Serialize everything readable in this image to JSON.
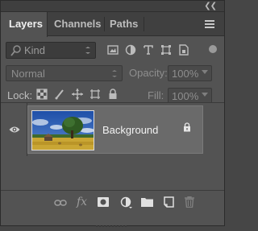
{
  "panel": {
    "tabs": [
      {
        "label": "Layers",
        "active": true
      },
      {
        "label": "Channels",
        "active": false
      },
      {
        "label": "Paths",
        "active": false
      }
    ]
  },
  "filter": {
    "kind_label": "Kind",
    "icons": [
      "pixel-filter-icon",
      "adjustment-filter-icon",
      "type-filter-icon",
      "shape-filter-icon",
      "smart-object-filter-icon"
    ]
  },
  "blend": {
    "mode": "Normal",
    "opacity_label": "Opacity:",
    "opacity_value": "100%"
  },
  "lock": {
    "label": "Lock:",
    "icons": [
      "lock-transparent-pixels-icon",
      "lock-image-pixels-icon",
      "lock-position-icon",
      "lock-artboard-icon",
      "lock-all-icon"
    ],
    "fill_label": "Fill:",
    "fill_value": "100%"
  },
  "layers": [
    {
      "name": "Background",
      "visible": true,
      "locked": true
    }
  ],
  "bottom_toolbar": {
    "icons": [
      "link-layers-icon",
      "layer-style-fx-icon",
      "add-mask-icon",
      "adjustment-layer-icon",
      "new-group-icon",
      "new-layer-icon",
      "delete-layer-icon"
    ],
    "fx_label": "fx"
  },
  "colors": {
    "panel_bg": "#535353",
    "tab_bar_bg": "#404040",
    "selected_layer_bg": "#6a6a6a"
  }
}
